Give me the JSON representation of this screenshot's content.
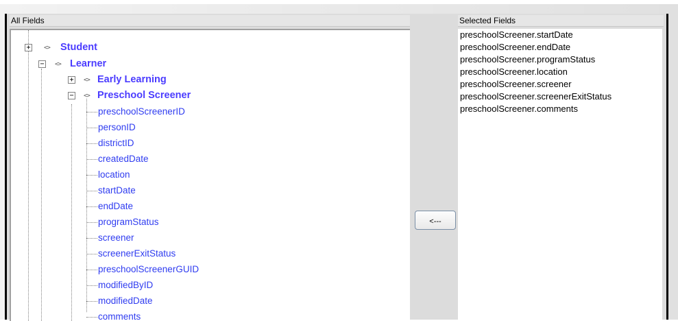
{
  "all_fields_label": "All Fields",
  "selected_fields_label": "Selected Fields",
  "move_button_label": "<---",
  "tree": {
    "student": "Student",
    "learner": "Learner",
    "early_learning": "Early Learning",
    "preschool_screener": "Preschool Screener",
    "fields": [
      "preschoolScreenerID",
      "personID",
      "districtID",
      "createdDate",
      "location",
      "startDate",
      "endDate",
      "programStatus",
      "screener",
      "screenerExitStatus",
      "preschoolScreenerGUID",
      "modifiedByID",
      "modifiedDate",
      "comments"
    ]
  },
  "selected_fields": [
    "preschoolScreener.startDate",
    "preschoolScreener.endDate",
    "preschoolScreener.programStatus",
    "preschoolScreener.location",
    "preschoolScreener.screener",
    "preschoolScreener.screenerExitStatus",
    "preschoolScreener.comments"
  ],
  "colors": {
    "node_bold": "#4b3cff",
    "leaf": "#2f3cf0"
  }
}
